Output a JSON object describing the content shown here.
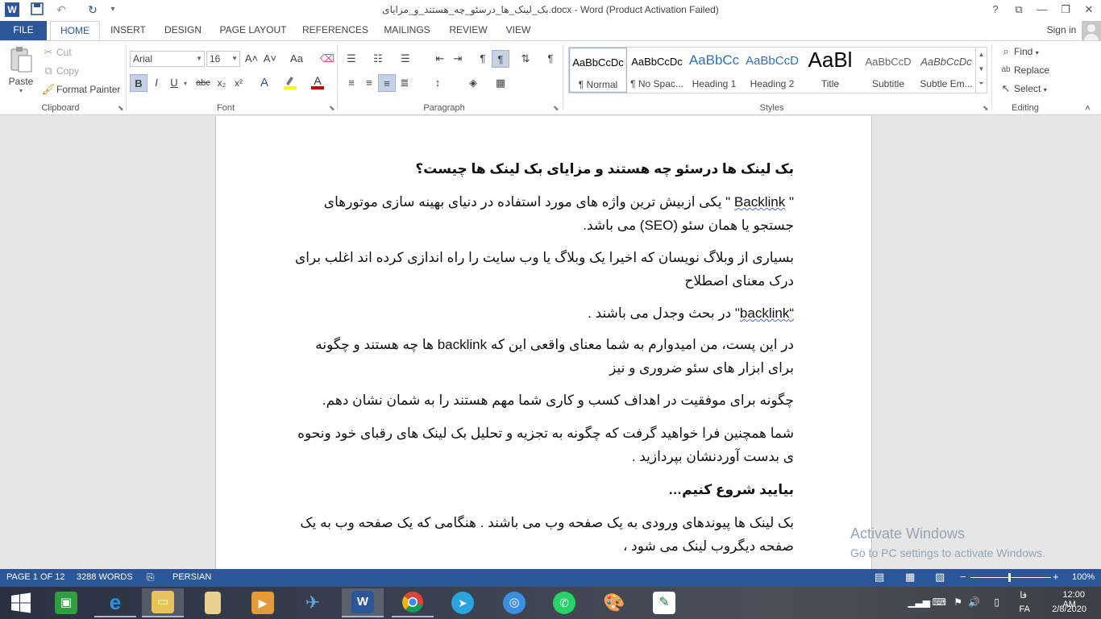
{
  "window": {
    "title": "بک_لینک_ها_درسئو_چه_هستند_و_مزایای.docx - Word (Product Activation Failed)",
    "help": "?",
    "ribbon_display": "⧉",
    "minimize": "—",
    "restore": "❐",
    "close": "✕"
  },
  "quick_access": {
    "word_icon": "W",
    "save_icon": "💾",
    "undo_icon": "↶",
    "redo_icon": "↻",
    "customize_icon": "▾"
  },
  "tabs": {
    "file": "FILE",
    "home": "HOME",
    "insert": "INSERT",
    "design": "DESIGN",
    "page_layout": "PAGE LAYOUT",
    "references": "REFERENCES",
    "mailings": "MAILINGS",
    "review": "REVIEW",
    "view": "VIEW",
    "sign_in": "Sign in"
  },
  "clipboard": {
    "paste": "Paste",
    "cut": "Cut",
    "copy": "Copy",
    "format_painter": "Format Painter",
    "label": "Clipboard"
  },
  "font": {
    "name": "Arial",
    "size": "16",
    "label": "Font",
    "bold": "B",
    "italic": "I",
    "underline": "U",
    "strike": "abc",
    "subscript": "x₂",
    "superscript": "x²",
    "grow": "A˄",
    "shrink": "A˅",
    "case": "Aa",
    "clear": "A"
  },
  "paragraph": {
    "label": "Paragraph"
  },
  "styles": {
    "label": "Styles",
    "items": [
      {
        "preview": "AaBbCcDc",
        "name": "¶ Normal"
      },
      {
        "preview": "AaBbCcDc",
        "name": "¶ No Spac..."
      },
      {
        "preview": "AaBbCc",
        "name": "Heading 1"
      },
      {
        "preview": "AaBbCcD",
        "name": "Heading 2"
      },
      {
        "preview": "AaBl",
        "name": "Title"
      },
      {
        "preview": "AaBbCcD",
        "name": "Subtitle"
      },
      {
        "preview": "AaBbCcDc",
        "name": "Subtle Em..."
      }
    ]
  },
  "editing": {
    "find": "Find",
    "replace": "Replace",
    "select": "Select",
    "label": "Editing"
  },
  "document": {
    "heading1": "بک لینک ها درسئو چه هستند و مزایای بک لینک ها چیست؟",
    "p1a": "\" ",
    "p1_link": "Backlink",
    "p1b": " \" یکی ازبیش ترین  واژه های مورد استفاده در دنیای  بهینه سازی موتورهای جستجو یا همان سئو (SEO) می باشد.",
    "p2": "بسیاری از وبلاگ نویسان که اخیرا یک وبلاگ یا وب سایت را راه اندازی کرده اند اغلب برای درک معنای اصطلاح",
    "p3_link": "“backlink",
    "p3b": "\" در بحث وجدل می باشند .",
    "p4": "در این پست، من امیدوارم به شما معنای واقعی این که backlink ها  چه هستند و چگونه برای ابزار های سئو ضروری و نیز",
    "p5": "چگونه برای موفقیت در اهداف کسب و کاری شما مهم هستند را به شمان نشان دهم.",
    "p6": " شما همچنین فرا خواهید گرفت که چگونه به تجزیه و تحلیل بک لینک های رقبای خود ونحوه ی بدست آوردنشان  بپردازید .",
    "heading2": "بیایید شروع کنیم…",
    "p7": "بک لینک ها پیوندهای ورودی به یک صفحه وب می باشند . هنگامی که یک صفحه وب به یک صفحه دیگروب لینک می شود ،"
  },
  "watermark": {
    "line1": "Activate Windows",
    "line2": "Go to PC settings to activate Windows."
  },
  "statusbar": {
    "page": "PAGE 1 OF 12",
    "words": "3288 WORDS",
    "language": "PERSIAN",
    "zoom": "100%",
    "minus": "−",
    "plus": "+"
  },
  "taskbar": {
    "time": "12:00 AM",
    "date": "2/8/2020",
    "lang_top": "فا",
    "lang_bottom": "FA"
  },
  "colors": {
    "accent": "#2b579a",
    "highlight": "#ffff00",
    "font_color": "#c00000"
  }
}
